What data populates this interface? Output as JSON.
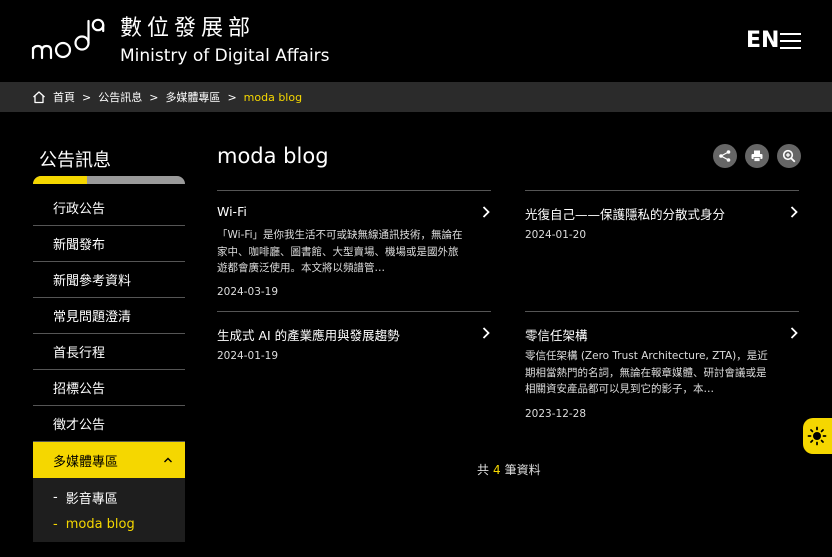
{
  "header": {
    "logo_word": "moda",
    "site_name_zh": "數位發展部",
    "site_name_en": "Ministry of Digital Affairs",
    "lang_toggle": "EN"
  },
  "breadcrumb": [
    "首頁",
    "公告訊息",
    "多媒體專區",
    "moda blog"
  ],
  "sidebar": {
    "title": "公告訊息",
    "items": [
      {
        "label": "行政公告"
      },
      {
        "label": "新聞發布"
      },
      {
        "label": "新聞參考資料"
      },
      {
        "label": "常見問題澄清"
      },
      {
        "label": "首長行程"
      },
      {
        "label": "招標公告"
      },
      {
        "label": "徵才公告"
      },
      {
        "label": "多媒體專區"
      }
    ],
    "sub_items": [
      {
        "label": "影音專區"
      },
      {
        "label": "moda blog"
      }
    ]
  },
  "main": {
    "title": "moda blog",
    "posts": [
      {
        "title": "Wi-Fi",
        "desc": "「Wi-Fi」是你我生活不可或缺無線通訊技術，無論在家中、咖啡廳、圖書館、大型賣場、機場或是國外旅遊都會廣泛使用。本文將以頻譜管…",
        "date": "2024-03-19"
      },
      {
        "title": "光復自己——保護隱私的分散式身分",
        "desc": "",
        "date": "2024-01-20"
      },
      {
        "title": "生成式 AI 的產業應用與發展趨勢",
        "desc": "",
        "date": "2024-01-19"
      },
      {
        "title": "零信任架構",
        "desc": "零信任架構 (Zero Trust Architecture, ZTA)，是近期相當熱門的名詞，無論在報章媒體、研討會議或是相關資安產品都可以見到它的影子，本…",
        "date": "2023-12-28"
      }
    ],
    "total_prefix": "共",
    "total_count": "4",
    "total_suffix": "筆資料"
  },
  "colors": {
    "accent": "#f5d700",
    "background": "#000000",
    "breadcrumb_bg": "#2b2b2b"
  }
}
